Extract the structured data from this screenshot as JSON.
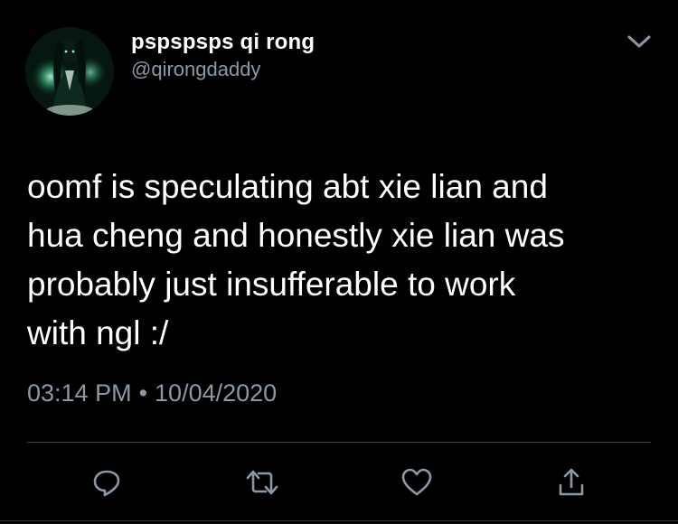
{
  "author": {
    "display_name": "pspspsps qi rong",
    "handle": "@qirongdaddy",
    "avatar_icon": "avatar-icon"
  },
  "tweet": {
    "text": "oomf is speculating abt xie lian and\nhua cheng and honestly xie lian was\nprobably just insufferable to work\nwith ngl :/",
    "time": "03:14 PM",
    "separator": "•",
    "date": "10/04/2020"
  },
  "actions": [
    {
      "name": "reply",
      "icon": "reply-icon"
    },
    {
      "name": "retweet",
      "icon": "retweet-icon"
    },
    {
      "name": "like",
      "icon": "heart-icon"
    },
    {
      "name": "share",
      "icon": "share-icon"
    }
  ],
  "colors": {
    "background": "#000000",
    "text": "#ffffff",
    "secondary_text": "#8b98a5",
    "divider": "#38444d"
  }
}
